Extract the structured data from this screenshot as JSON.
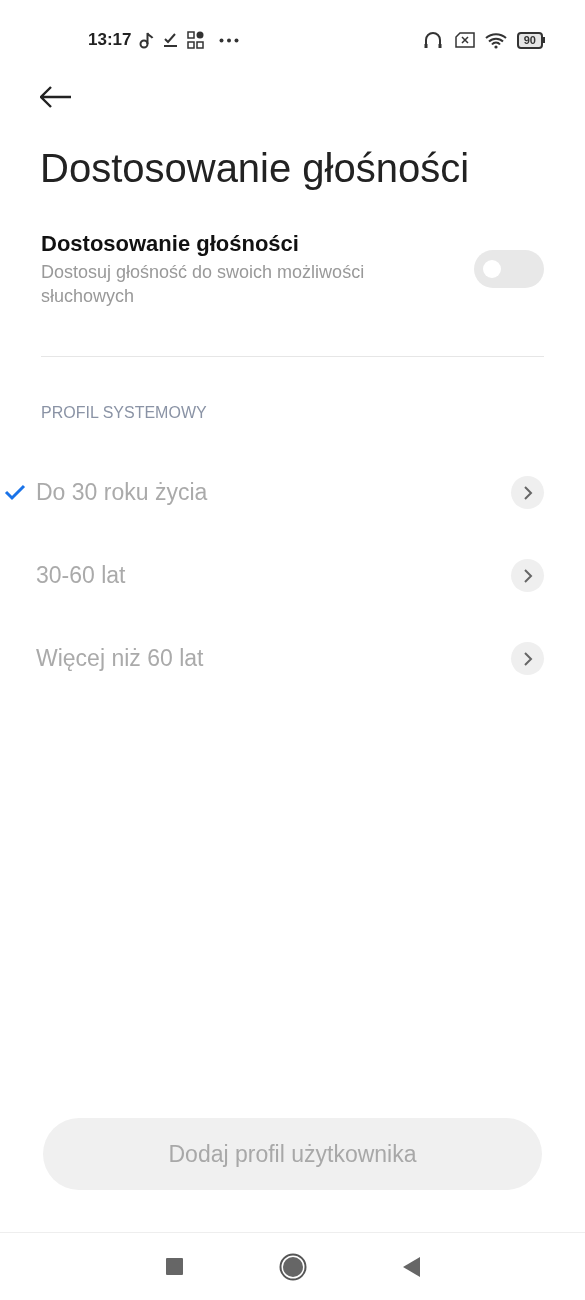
{
  "status_bar": {
    "time": "13:17",
    "battery": "90"
  },
  "title": "Dostosowanie głośności",
  "setting": {
    "label": "Dostosowanie głośności",
    "description": "Dostosuj głośność do swoich możliwości słuchowych",
    "on": false
  },
  "section": "PROFIL SYSTEMOWY",
  "profiles": [
    {
      "label": "Do 30 roku życia",
      "selected": true
    },
    {
      "label": "30-60 lat",
      "selected": false
    },
    {
      "label": "Więcej niż 60 lat",
      "selected": false
    }
  ],
  "button": {
    "label": "Dodaj profil użytkownika",
    "disabled": true
  }
}
